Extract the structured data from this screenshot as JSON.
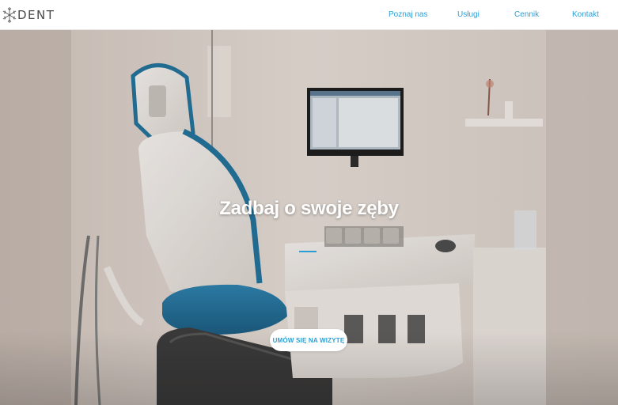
{
  "brand": {
    "logo_text": "DENT",
    "logo_icon": "snowflake-logo-icon"
  },
  "nav": {
    "items": [
      {
        "label": "Poznaj nas"
      },
      {
        "label": "Usługi"
      },
      {
        "label": "Cennik"
      },
      {
        "label": "Kontakt"
      }
    ]
  },
  "hero": {
    "title": "Zadbaj o swoje zęby",
    "cta_label": "UMÓW SIĘ NA WIZYTĘ"
  },
  "colors": {
    "accent": "#2a9fd6",
    "header_bg": "#ffffff",
    "chair_blue": "#1f6f9a"
  }
}
